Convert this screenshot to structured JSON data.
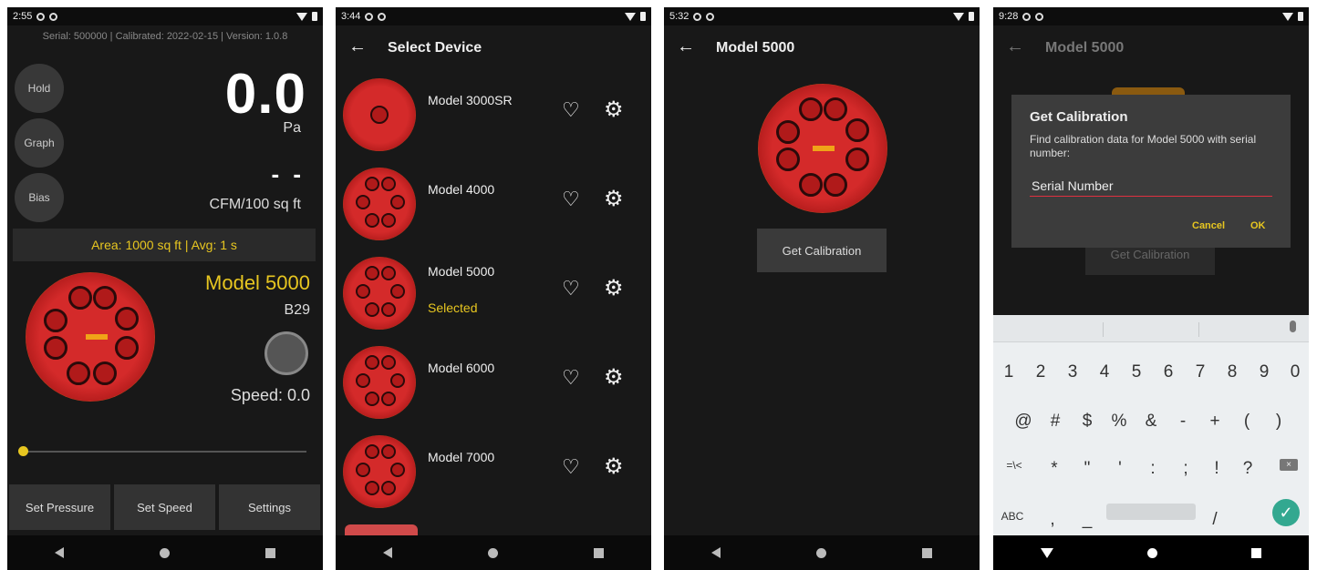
{
  "colors": {
    "accent": "#e7c620",
    "background": "#181818",
    "fan_red": "#d42a2a",
    "fan_rim": "#e1a41b",
    "enter": "#33a890",
    "input_underline": "#e03040"
  },
  "screen1": {
    "status_time": "2:55",
    "info": "Serial: 500000 | Calibrated: 2022-02-15 | Version: 1.0.8",
    "hold": "Hold",
    "graph": "Graph",
    "bias": "Bias",
    "pressure_value": "0.0",
    "pressure_unit": "Pa",
    "flow_value": "- -",
    "flow_unit": "CFM/100 sq ft",
    "area_avg": "Area: 1000 sq ft | Avg: 1 s",
    "model": "Model 5000",
    "ring": "B29",
    "speed": "Speed: 0.0",
    "buttons": [
      "Set Pressure",
      "Set Speed",
      "Settings"
    ]
  },
  "screen2": {
    "status_time": "3:44",
    "title": "Select Device",
    "devices": [
      {
        "name": "Model 3000SR",
        "status": ""
      },
      {
        "name": "Model 4000",
        "status": ""
      },
      {
        "name": "Model 5000",
        "status": "Selected"
      },
      {
        "name": "Model 6000",
        "status": ""
      },
      {
        "name": "Model 7000",
        "status": ""
      }
    ]
  },
  "screen3": {
    "status_time": "5:32",
    "title": "Model 5000",
    "button": "Get Calibration"
  },
  "screen4": {
    "status_time": "9:28",
    "title": "Model 5000",
    "button": "Get Calibration",
    "dialog": {
      "title": "Get Calibration",
      "message": "Find calibration data for Model 5000 with serial number:",
      "placeholder": "Serial Number",
      "cancel": "Cancel",
      "ok": "OK"
    },
    "keyboard": {
      "row1": [
        "1",
        "2",
        "3",
        "4",
        "5",
        "6",
        "7",
        "8",
        "9",
        "0"
      ],
      "row2": [
        "@",
        "#",
        "$",
        "%",
        "&",
        "-",
        "+",
        "(",
        ")"
      ],
      "row3": [
        "=\\<",
        "*",
        "\"",
        "'",
        ":",
        ";",
        "!",
        "?"
      ],
      "row4": [
        "ABC",
        ",",
        "_",
        "/"
      ]
    }
  }
}
